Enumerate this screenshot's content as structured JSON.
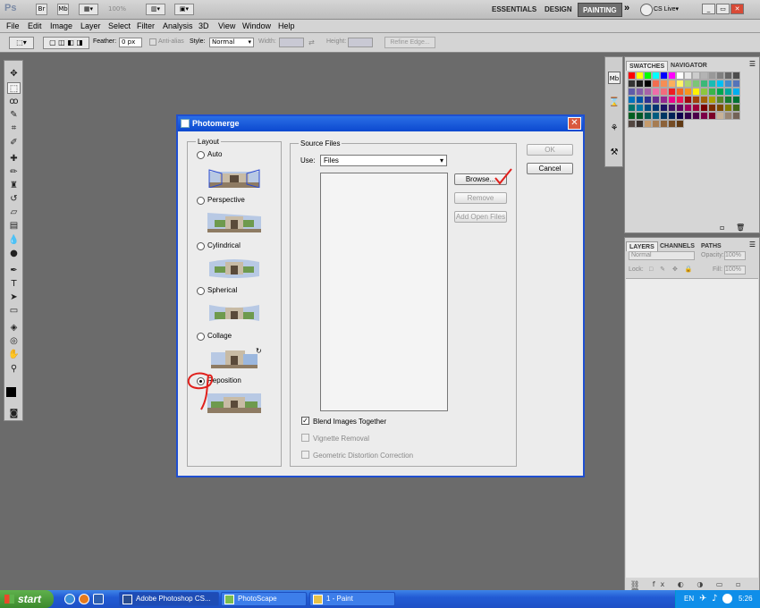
{
  "appbar": {
    "logo": "Ps",
    "br": "Br",
    "mb": "Mb",
    "zoom": "100%",
    "workspaces": [
      "ESSENTIALS",
      "DESIGN",
      "PAINTING"
    ],
    "active_workspace": "PAINTING",
    "more": "»",
    "cslive": "CS Live"
  },
  "menu": [
    "File",
    "Edit",
    "Image",
    "Layer",
    "Select",
    "Filter",
    "Analysis",
    "3D",
    "View",
    "Window",
    "Help"
  ],
  "options": {
    "feather_label": "Feather:",
    "feather_value": "0 px",
    "antialias_label": "Anti-alias",
    "style_label": "Style:",
    "style_value": "Normal",
    "width_label": "Width:",
    "height_label": "Height:",
    "refine_label": "Refine Edge..."
  },
  "panels": {
    "swatches_tab": "SWATCHES",
    "navigator_tab": "NAVIGATOR",
    "layers_tab": "LAYERS",
    "channels_tab": "CHANNELS",
    "paths_tab": "PATHS",
    "blend_mode": "Normal",
    "opacity_label": "Opacity:",
    "opacity_value": "100%",
    "lock_label": "Lock:",
    "fill_label": "Fill:",
    "fill_value": "100%"
  },
  "dialog": {
    "title": "Photomerge",
    "layout_label": "Layout",
    "layouts": [
      "Auto",
      "Perspective",
      "Cylindrical",
      "Spherical",
      "Collage",
      "Reposition"
    ],
    "selected_layout": "Reposition",
    "source_label": "Source Files",
    "use_label": "Use:",
    "use_value": "Files",
    "browse": "Browse...",
    "remove": "Remove",
    "add_open": "Add Open Files",
    "ok": "OK",
    "cancel": "Cancel",
    "blend": "Blend Images Together",
    "vignette": "Vignette Removal",
    "geometric": "Geometric Distortion Correction"
  },
  "taskbar": {
    "start": "start",
    "items": [
      "Adobe Photoshop CS...",
      "PhotoScape",
      "1 - Paint"
    ],
    "lang": "EN",
    "time": "5:26"
  },
  "colors": {
    "dialog_border": "#1f4fd0",
    "taskbar": "#225bd4",
    "annotation": "#e0201c"
  }
}
